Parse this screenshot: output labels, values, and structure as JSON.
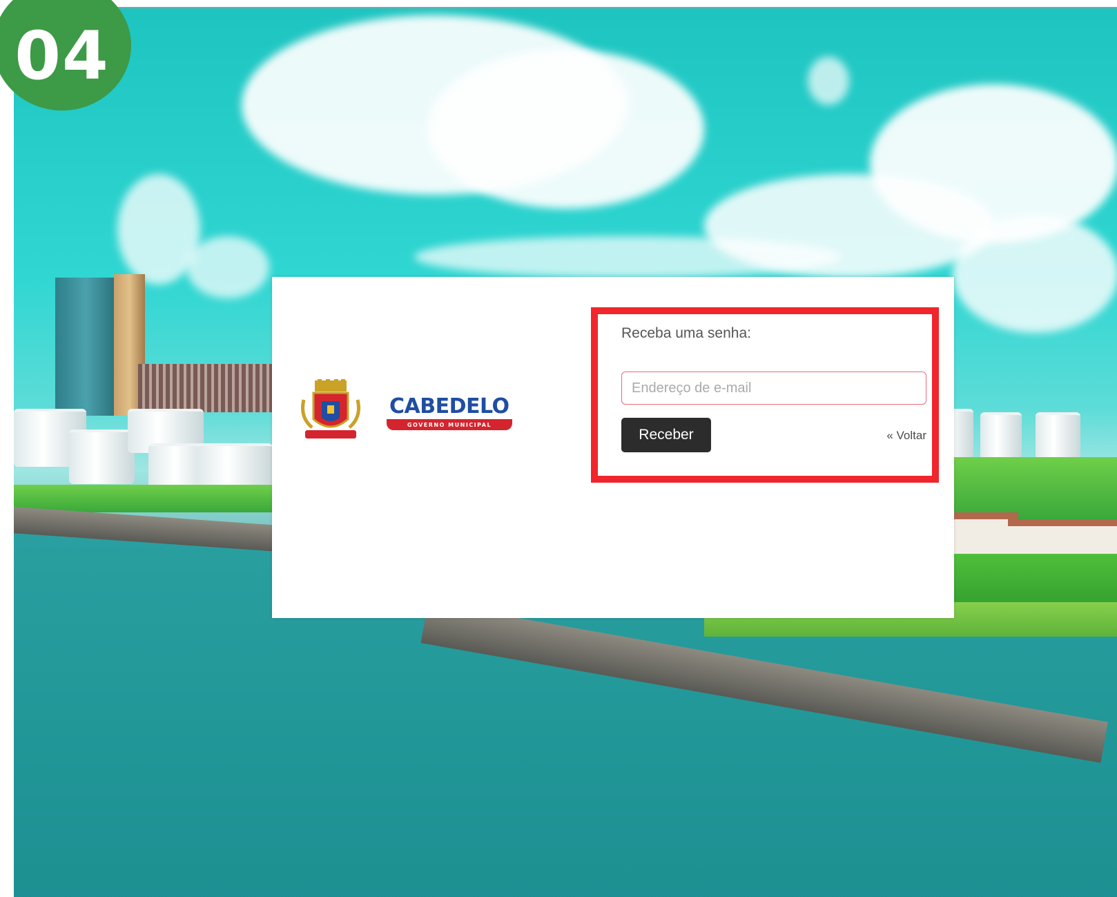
{
  "step_badge": {
    "number": "04",
    "color": "#3d9a46"
  },
  "logo": {
    "title": "CABEDELO",
    "subtitle": "GOVERNO MUNICIPAL",
    "title_color": "#1f4ea3",
    "subtitle_color": "#d4242e"
  },
  "form": {
    "label": "Receba uma senha:",
    "email_placeholder": "Endereço de e-mail",
    "email_value": "",
    "submit_label": "Receber",
    "back_link": "« Voltar"
  },
  "highlight_color": "#f0262c"
}
